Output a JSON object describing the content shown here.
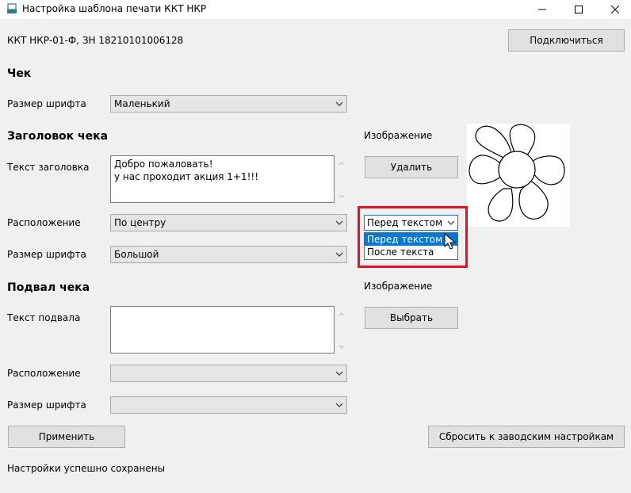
{
  "window": {
    "title": "Настройка шаблона печати ККТ НКР"
  },
  "device": {
    "info": "ККТ НКР-01-Ф, ЗН 18210101006128",
    "connect_label": "Подключиться"
  },
  "receipt": {
    "heading": "Чек",
    "font_size_label": "Размер шрифта",
    "font_size_value": "Маленький"
  },
  "header": {
    "heading": "Заголовок чека",
    "text_label": "Текст заголовка",
    "text_lines": [
      "Добро пожаловать!",
      "у нас проходит акция 1+1!!!"
    ],
    "position_label": "Расположение",
    "position_value": "По центру",
    "font_size_label": "Размер шрифта",
    "font_size_value": "Большой",
    "image_label": "Изображение",
    "delete_label": "Удалить",
    "image_placement_value": "Перед текстом",
    "image_placement_options": [
      "Перед текстом",
      "После текста"
    ],
    "image_placement_selected_index": 0
  },
  "footer": {
    "heading": "Подвал чека",
    "text_label": "Текст подвала",
    "text_value": "",
    "position_label": "Расположение",
    "position_value": "",
    "font_size_label": "Размер шрифта",
    "font_size_value": "",
    "image_label": "Изображение",
    "choose_label": "Выбрать"
  },
  "actions": {
    "apply_label": "Применить",
    "reset_label": "Сбросить к заводским настройкам"
  },
  "status": {
    "message": "Настройки успешно сохранены"
  },
  "colors": {
    "highlight_border": "#e81123",
    "selection": "#0078d7",
    "window_bg": "#f0f0f0"
  },
  "icons": [
    "app-icon",
    "minimize-icon",
    "maximize-icon",
    "close-icon",
    "chevron-down-icon",
    "scroll-up-icon",
    "scroll-down-icon",
    "mouse-cursor-icon"
  ]
}
